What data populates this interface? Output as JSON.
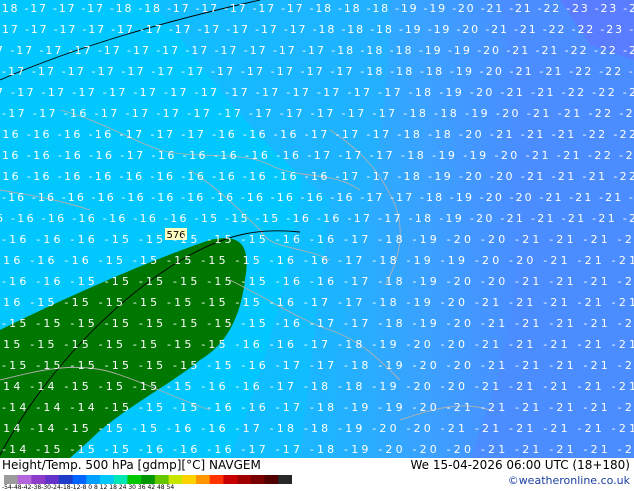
{
  "map": {
    "colors": {
      "minus14": "#007700",
      "minus15_16": "#00c8ff",
      "minus17_18": "#1eb4ff",
      "minus19_20": "#3ca0ff",
      "minus21_22": "#4b8cff",
      "minus23": "#5a7dff",
      "coast": "#9a9a9a",
      "isoline": "#000000"
    },
    "height_label": "576",
    "rows": [
      "-18 -17 -17 -17 -18 -18 -17 -17 -17 -17 -17 -18 -18 -18 -19 -19 -20 -21 -21 -22 -23 -23 -2",
      "17 -17 -17 -17 -17 -17 -17 -17 -17 -17 -17 -18 -18 -18 -19 -19 -20 -21 -21 -22 -22 -23 -2",
      "7 -17 -17 -17 -17 -17 -17 -17 -17 -17 -17 -17 -18 -18 -18 -19 -19 -20 -21 -21 -22 -22 -2",
      "-17 -17 -17 -17 -17 -17 -17 -17 -17 -17 -17 -17 -18 -18 -18 -19 -20 -21 -21 -22 -22 -2",
      "7 -17 -17 -17 -17 -17 -17 -17 -17 -17 -17 -17 -17 -17 -18 -19 -20 -21 -21 -22 -22 -2",
      "-17 -17 -16 -17 -17 -17 -17 -17 -17 -17 -17 -17 -17 -18 -18 -19 -20 -21 -21 -22 -22",
      "-16 -16 -16 -16 -17 -17 -17 -16 -16 -16 -17 -17 -17 -18 -18 -20 -21 -21 -21 -22 -22",
      "16 -16 -16 -16 -17 -16 -16 -16 -16 -16 -17 -17 -17 -18 -19 -19 -20 -21 -21 -22 -22",
      "-16 -16 -16 -16 -16 -16 -16 -16 -16 -16 -16 -17 -17 -18 -19 -20 -20 -21 -21 -21 -22",
      "-16 -16 -16 -16 -16 -16 -16 -16 -16 -16 -16 -16 -17 -17 -18 -19 -20 -20 -21 -21 -21 -2",
      "6 -16 -16 -16 -16 -16 -16 -15 -15 -15 -16 -16 -17 -17 -18 -19 -20 -21 -21 -21 -21 -2",
      "-16 -16 -16 -15 -15 -15 -15 -15 -16 -16 -17 -18 -19 -20 -20 -21 -21 -21 -21",
      "-16 -16 -16 -15 -15 -15 -15 -15 -16 -16 -17 -18 -19 -19 -20 -20 -21 -21 -21",
      "-16 -16 -15 -15 -15 -15 -15 -15 -16 -16 -17 -18 -19 -20 -20 -21 -21 -21 -21",
      "-16 -15 -15 -15 -15 -15 -15 -15 -16 -17 -17 -18 -19 -20 -21 -21 -21 -21 -21",
      "-15 -15 -15 -15 -15 -15 -15 -15 -16 -17 -17 -18 -19 -20 -21 -21 -21 -21 -21",
      "-15 -15 -15 -15 -15 -15 -15 -16 -16 -17 -18 -19 -20 -20 -21 -21 -21 -21 -21",
      "-15 -15 -15 -15 -15 -15 -15 -16 -17 -17 -18 -19 -20 -20 -21 -21 -21 -21 -21",
      "-14 -14 -15 -15 -15 -15 -16 -16 -17 -18 -18 -19 -20 -20 -21 -21 -21 -21 -21",
      "-14 -14 -14 -15 -15 -15 -16 -16 -17 -18 -19 -19 -20 -21 -21 -21 -21 -21 -21",
      "-14 -14 -15 -15 -15 -16 -16 -17 -18 -18 -19 -20 -20 -21 -21 -21 -21 -21 -21",
      "-14 -15 -15 -15 -16 -16 -16 -17 -17 -18 -19 -20 -20 -20 -21 -21 -21 -21 -21"
    ]
  },
  "footer": {
    "title_left": "Height/Temp. 500 hPa [gdmp][°C] NAVGEM",
    "title_right": "We 15-04-2026 06:00 UTC (18+180)",
    "credit": "©weatheronline.co.uk",
    "scale_labels": "-54-48-42-38-30-24-18-12-8 0 8 12 18 24 30 36 42 48 54",
    "scale_colors": [
      "#9b9b9b",
      "#b464dc",
      "#8c3cc8",
      "#6432c8",
      "#1e3cc8",
      "#0064ff",
      "#00a0ff",
      "#00c8ff",
      "#00e6b4",
      "#00c800",
      "#009600",
      "#64c800",
      "#c8e600",
      "#ffd200",
      "#ff9600",
      "#ff3200",
      "#c80000",
      "#a00000",
      "#780000",
      "#500000",
      "#282828"
    ]
  }
}
